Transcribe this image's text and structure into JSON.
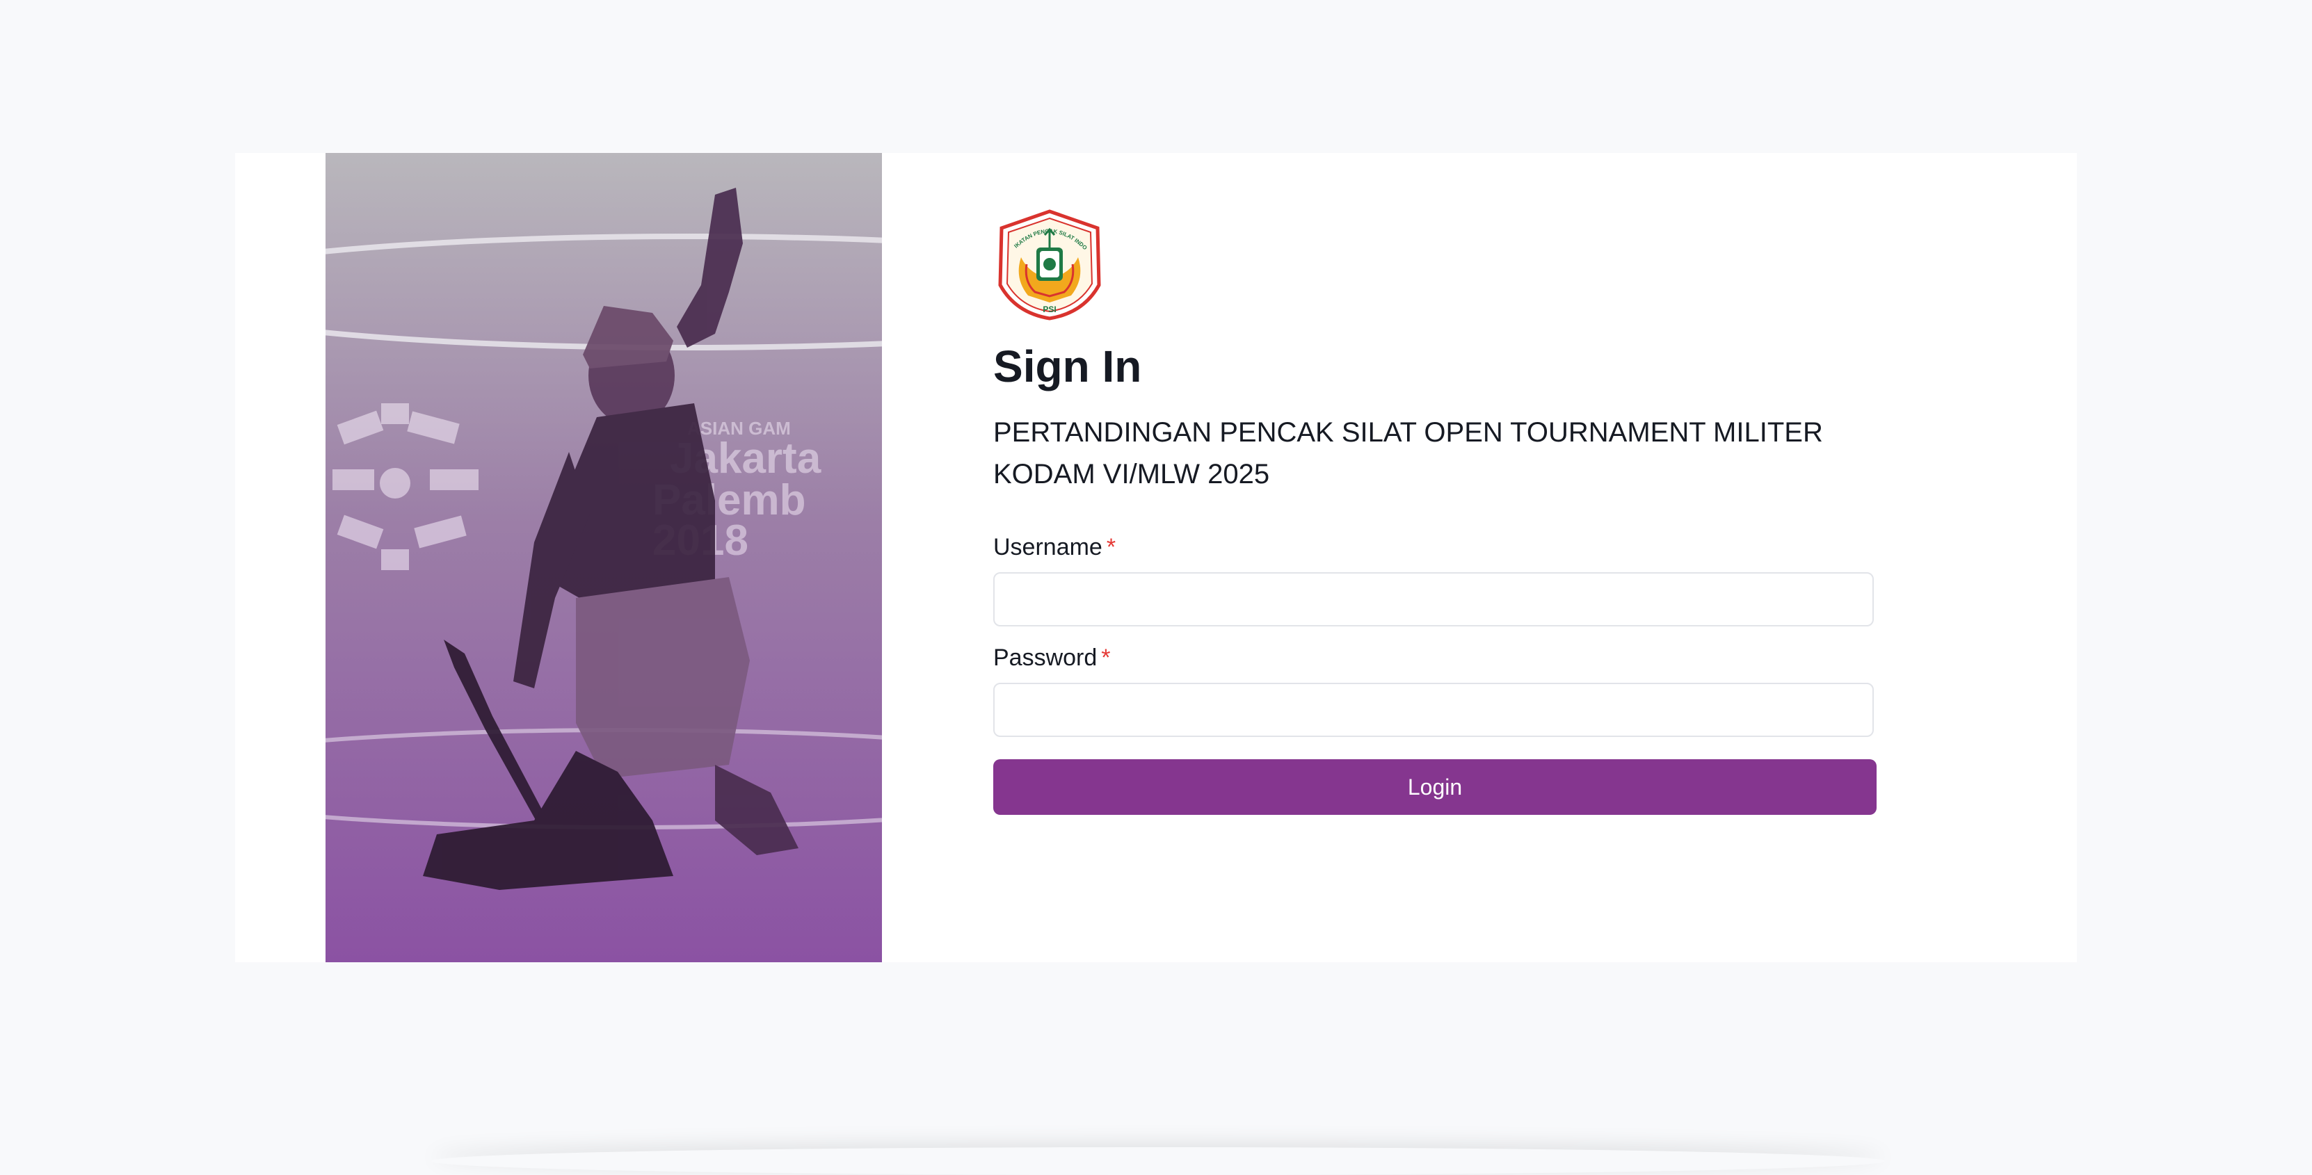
{
  "hero": {
    "image_desc_icon": "pencak-silat-athlete-photo",
    "watermark_text_lines": [
      "ASIAN GAMES",
      "Jakarta",
      "Palembang",
      "2018"
    ]
  },
  "logo": {
    "icon": "ipsi-emblem-icon",
    "arc_text": "IKATAN PENCAK SILAT INDONESIA",
    "bottom_text": "IPSI"
  },
  "form": {
    "title": "Sign In",
    "subtitle": "PERTANDINGAN PENCAK SILAT OPEN TOURNAMENT MILITER KODAM VI/MLW 2025",
    "username_label": "Username",
    "username_value": "",
    "password_label": "Password",
    "password_value": "",
    "required_mark": "*",
    "login_label": "Login"
  },
  "colors": {
    "primary": "#85368f",
    "required": "#e53935",
    "background": "#f8f9fb"
  }
}
